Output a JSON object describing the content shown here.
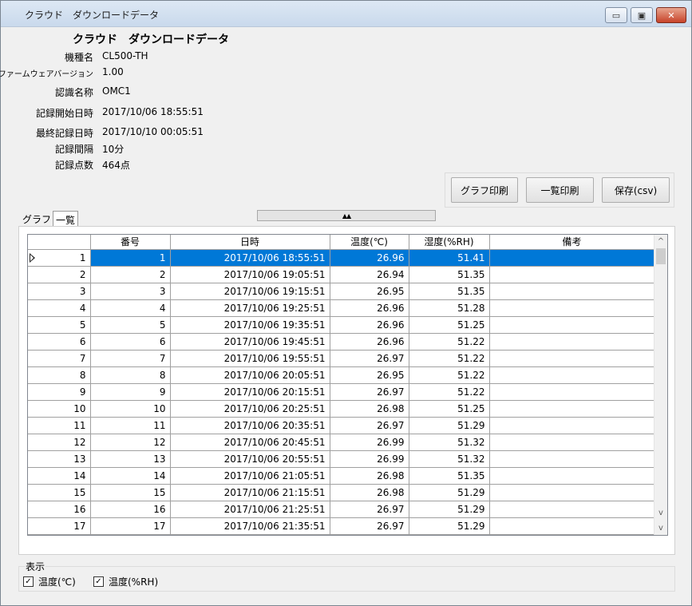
{
  "window": {
    "title": "クラウド　ダウンロードデータ",
    "controls": {
      "minimize": "▭",
      "maximize": "▣",
      "close": "✕"
    }
  },
  "info": {
    "heading": "クラウド　ダウンロードデータ",
    "rows": [
      {
        "label": "機種名",
        "value": "CL500-TH"
      },
      {
        "label": "ファームウェアバージョン",
        "value": "1.00"
      },
      {
        "label": "認識名称",
        "value": "OMC1"
      },
      {
        "label": "記録開始日時",
        "value": "2017/10/06 18:55:51"
      },
      {
        "label": "最終記録日時",
        "value": "2017/10/10 00:05:51"
      },
      {
        "label": "記録間隔",
        "value": "10分"
      },
      {
        "label": "記録点数",
        "value": "464点"
      }
    ]
  },
  "buttons": {
    "graph_print": "グラフ印刷",
    "list_print": "一覧印刷",
    "save_csv": "保存(csv)"
  },
  "tabs": [
    {
      "label": "グラフ",
      "active": false
    },
    {
      "label": "一覧",
      "active": true
    }
  ],
  "splitter_label": "▲▲",
  "grid": {
    "columns": [
      "",
      "番号",
      "日時",
      "温度(℃)",
      "湿度(%RH)",
      "備考"
    ],
    "selected_row": 1,
    "rows": [
      [
        "1",
        "1",
        "2017/10/06 18:55:51",
        "26.96",
        "51.41",
        ""
      ],
      [
        "2",
        "2",
        "2017/10/06 19:05:51",
        "26.94",
        "51.35",
        ""
      ],
      [
        "3",
        "3",
        "2017/10/06 19:15:51",
        "26.95",
        "51.35",
        ""
      ],
      [
        "4",
        "4",
        "2017/10/06 19:25:51",
        "26.96",
        "51.28",
        ""
      ],
      [
        "5",
        "5",
        "2017/10/06 19:35:51",
        "26.96",
        "51.25",
        ""
      ],
      [
        "6",
        "6",
        "2017/10/06 19:45:51",
        "26.96",
        "51.22",
        ""
      ],
      [
        "7",
        "7",
        "2017/10/06 19:55:51",
        "26.97",
        "51.22",
        ""
      ],
      [
        "8",
        "8",
        "2017/10/06 20:05:51",
        "26.95",
        "51.22",
        ""
      ],
      [
        "9",
        "9",
        "2017/10/06 20:15:51",
        "26.97",
        "51.22",
        ""
      ],
      [
        "10",
        "10",
        "2017/10/06 20:25:51",
        "26.98",
        "51.25",
        ""
      ],
      [
        "11",
        "11",
        "2017/10/06 20:35:51",
        "26.97",
        "51.29",
        ""
      ],
      [
        "12",
        "12",
        "2017/10/06 20:45:51",
        "26.99",
        "51.32",
        ""
      ],
      [
        "13",
        "13",
        "2017/10/06 20:55:51",
        "26.99",
        "51.32",
        ""
      ],
      [
        "14",
        "14",
        "2017/10/06 21:05:51",
        "26.98",
        "51.35",
        ""
      ],
      [
        "15",
        "15",
        "2017/10/06 21:15:51",
        "26.98",
        "51.29",
        ""
      ],
      [
        "16",
        "16",
        "2017/10/06 21:25:51",
        "26.97",
        "51.29",
        ""
      ],
      [
        "17",
        "17",
        "2017/10/06 21:35:51",
        "26.97",
        "51.29",
        ""
      ]
    ]
  },
  "scrollbar": {
    "up": "^",
    "down": "v"
  },
  "display": {
    "legend": "表示",
    "options": [
      {
        "label": "温度(℃)",
        "checked": true,
        "mark": "✓"
      },
      {
        "label": "温度(%RH)",
        "checked": true,
        "mark": "✓"
      }
    ]
  },
  "colors": {
    "selection": "#0078d7",
    "titlebar": "#dde8f4"
  }
}
